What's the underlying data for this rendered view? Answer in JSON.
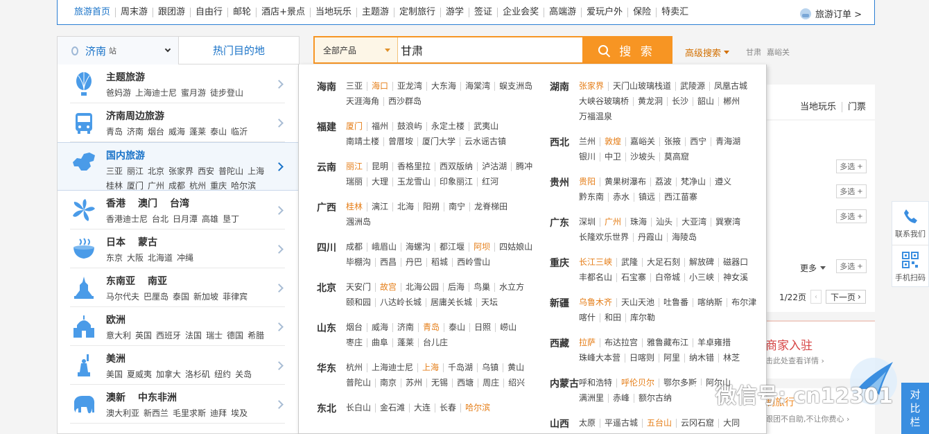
{
  "top_nav": {
    "items": [
      "旅游首页",
      "周末游",
      "跟团游",
      "自由行",
      "邮轮",
      "酒店+景点",
      "当地玩乐",
      "主题游",
      "定制旅行",
      "游学",
      "签证",
      "企业会奖",
      "高端游",
      "爱玩户外",
      "保险",
      "特卖汇"
    ],
    "orders_label": "旅游订单 >"
  },
  "city_selector": {
    "city": "济南",
    "suffix": "站"
  },
  "hot_tab": "热门目的地",
  "categories": [
    {
      "titles": [
        "主题旅游"
      ],
      "links": [
        "爸妈游",
        "上海迪士尼",
        "蜜月游",
        "徒步登山"
      ],
      "icon": "balloon-icon"
    },
    {
      "titles": [
        "济南周边旅游"
      ],
      "links": [
        "青岛",
        "济南",
        "烟台",
        "威海",
        "蓬莱",
        "泰山",
        "临沂"
      ],
      "icon": "bus-icon"
    },
    {
      "titles": [
        "国内旅游"
      ],
      "links": [
        "三亚",
        "丽江",
        "北京",
        "张家界",
        "西安",
        "普陀山",
        "上海"
      ],
      "links2": [
        "桂林",
        "厦门",
        "广州",
        "成都",
        "杭州",
        "重庆",
        "哈尔滨"
      ],
      "icon": "china-map-icon"
    },
    {
      "titles": [
        "香港",
        "澳门",
        "台湾"
      ],
      "links": [
        "香港迪士尼",
        "台北",
        "日月潭",
        "高雄",
        "垦丁"
      ],
      "icon": "bauhinia-icon"
    },
    {
      "titles": [
        "日本",
        "蒙古"
      ],
      "links": [
        "东京",
        "大阪",
        "北海道",
        "冲绳"
      ],
      "icon": "ramen-icon"
    },
    {
      "titles": [
        "东南亚",
        "南亚"
      ],
      "links": [
        "马尔代夫",
        "巴厘岛",
        "泰国",
        "新加坡",
        "菲律宾"
      ],
      "icon": "temple-icon"
    },
    {
      "titles": [
        "欧洲"
      ],
      "links": [
        "意大利",
        "英国",
        "西班牙",
        "法国",
        "瑞士",
        "德国",
        "希腊"
      ],
      "icon": "cathedral-icon"
    },
    {
      "titles": [
        "美洲"
      ],
      "links": [
        "美国",
        "夏威夷",
        "加拿大",
        "洛杉矶",
        "纽约",
        "关岛"
      ],
      "icon": "statue-of-liberty-icon"
    },
    {
      "titles": [
        "澳新",
        "中东非洲"
      ],
      "links": [
        "澳大利亚",
        "新西兰",
        "毛里求斯",
        "迪拜",
        "埃及"
      ],
      "icon": "elephant-icon"
    }
  ],
  "search": {
    "product_type": "全部产品",
    "query": "甘肃",
    "button_label": "搜 索"
  },
  "advanced": {
    "label": "高级搜索",
    "words": [
      "甘肃",
      "嘉峪关"
    ]
  },
  "dropdown": {
    "left": [
      {
        "name": "海南",
        "places": [
          "三亚",
          "海口",
          "亚龙湾",
          "大东海",
          "海棠湾",
          "蜈支洲岛",
          "天涯海角",
          "西沙群岛"
        ],
        "hot": [
          1
        ]
      },
      {
        "name": "福建",
        "places": [
          "厦门",
          "福州",
          "鼓浪屿",
          "永定土楼",
          "武夷山",
          "南靖土楼",
          "曾厝垵",
          "厦门大学",
          "云水谣古镇"
        ],
        "hot": [
          0
        ]
      },
      {
        "name": "云南",
        "places": [
          "丽江",
          "昆明",
          "香格里拉",
          "西双版纳",
          "泸沽湖",
          "腾冲",
          "瑞丽",
          "大理",
          "玉龙雪山",
          "印象丽江",
          "红河"
        ],
        "hot": [
          0
        ]
      },
      {
        "name": "广西",
        "places": [
          "桂林",
          "漓江",
          "北海",
          "阳朔",
          "南宁",
          "龙脊梯田",
          "涠洲岛"
        ],
        "hot": [
          0
        ]
      },
      {
        "name": "四川",
        "places": [
          "成都",
          "峨眉山",
          "海螺沟",
          "都江堰",
          "阿坝",
          "四姑娘山",
          "毕棚沟",
          "西昌",
          "丹巴",
          "稻城",
          "西岭雪山"
        ],
        "hot": [
          4
        ]
      },
      {
        "name": "北京",
        "places": [
          "天安门",
          "故宫",
          "北海公园",
          "后海",
          "鸟巢",
          "水立方",
          "颐和园",
          "八达岭长城",
          "居庸关长城",
          "天坛"
        ],
        "hot": [
          1
        ]
      },
      {
        "name": "山东",
        "places": [
          "烟台",
          "威海",
          "济南",
          "青岛",
          "泰山",
          "日照",
          "崂山",
          "枣庄",
          "曲阜",
          "蓬莱",
          "台儿庄"
        ],
        "hot": [
          3
        ]
      },
      {
        "name": "华东",
        "places": [
          "杭州",
          "上海迪士尼",
          "上海",
          "千岛湖",
          "乌镇",
          "黄山",
          "普陀山",
          "南京",
          "苏州",
          "无锡",
          "西塘",
          "周庄",
          "绍兴"
        ],
        "hot": [
          2
        ]
      },
      {
        "name": "东北",
        "places": [
          "长白山",
          "金石滩",
          "大连",
          "长春",
          "哈尔滨"
        ],
        "hot": [
          4
        ]
      }
    ],
    "right": [
      {
        "name": "湖南",
        "places": [
          "张家界",
          "天门山玻璃栈道",
          "武陵源",
          "凤凰古城",
          "大峡谷玻璃桥",
          "黄龙洞",
          "长沙",
          "韶山",
          "郴州",
          "万福温泉"
        ],
        "hot": [
          0
        ]
      },
      {
        "name": "西北",
        "places": [
          "兰州",
          "敦煌",
          "嘉峪关",
          "张掖",
          "西宁",
          "青海湖",
          "银川",
          "中卫",
          "沙坡头",
          "莫高窟"
        ],
        "hot": [
          1
        ]
      },
      {
        "name": "贵州",
        "places": [
          "贵阳",
          "黄果树瀑布",
          "荔波",
          "梵净山",
          "遵义",
          "黔东南",
          "赤水",
          "镇远",
          "西江苗寨"
        ],
        "hot": [
          0
        ]
      },
      {
        "name": "广东",
        "places": [
          "深圳",
          "广州",
          "珠海",
          "汕头",
          "大亚湾",
          "巽寮湾",
          "长隆欢乐世界",
          "丹霞山",
          "海陵岛"
        ],
        "hot": [
          1
        ]
      },
      {
        "name": "重庆",
        "places": [
          "长江三峡",
          "武隆",
          "大足石刻",
          "解放碑",
          "磁器口",
          "丰都名山",
          "石宝寨",
          "白帝城",
          "小三峡",
          "神女溪"
        ],
        "hot": [
          0
        ]
      },
      {
        "name": "新疆",
        "places": [
          "乌鲁木齐",
          "天山天池",
          "吐鲁番",
          "喀纳斯",
          "布尔津",
          "喀什",
          "和田",
          "库尔勒"
        ],
        "hot": [
          0
        ]
      },
      {
        "name": "西藏",
        "places": [
          "拉萨",
          "布达拉宫",
          "雅鲁藏布江",
          "羊卓雍措",
          "珠峰大本营",
          "日喀则",
          "阿里",
          "纳木错",
          "林芝"
        ],
        "hot": [
          0
        ]
      },
      {
        "name": "内蒙古",
        "places": [
          "呼和浩特",
          "呼伦贝尔",
          "鄂尔多斯",
          "阿尔山",
          "满洲里",
          "赤峰",
          "额尔古纳"
        ],
        "hot": [
          1
        ]
      },
      {
        "name": "山西",
        "places": [
          "太原",
          "平遥古城",
          "五台山",
          "云冈石窟",
          "大同"
        ],
        "hot": [
          2
        ]
      }
    ]
  },
  "background": {
    "tabs": [
      "当地玩乐",
      "门票"
    ],
    "multi_label": "多选",
    "more_label": "更多",
    "pager_text": "1/22页",
    "next_label": "下一页",
    "merchant_title": "商家入驻",
    "merchant_sub": "击此处查看详情",
    "travel_title": "制旅行",
    "travel_sub": "跟团不自助,不让你费心"
  },
  "float": {
    "contact": "联系我们",
    "scan": "手机扫码",
    "compare": [
      "对",
      "比",
      "栏"
    ]
  },
  "watermark": "微信号: cn12301",
  "colors": {
    "brand_blue": "#1a73c8",
    "search_orange": "#f79523",
    "hot_orange": "#e57e18"
  }
}
